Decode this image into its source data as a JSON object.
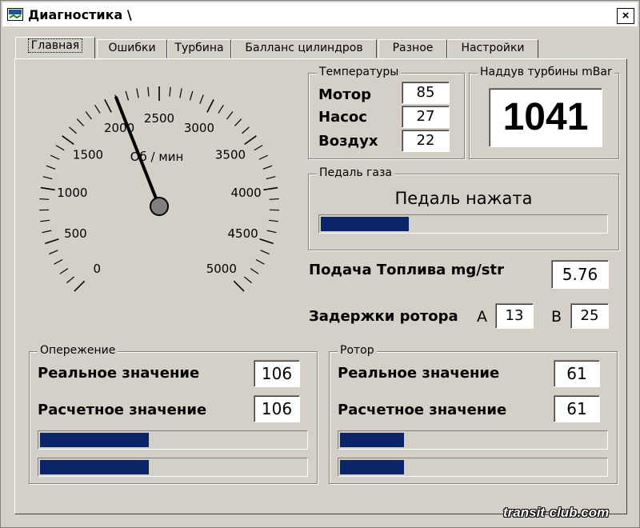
{
  "window": {
    "title": "Диагностика \\",
    "close": "×"
  },
  "tabs": [
    {
      "label": "Главная",
      "active": true
    },
    {
      "label": "Ошибки",
      "active": false
    },
    {
      "label": "Турбина",
      "active": false
    },
    {
      "label": "Балланс цилиндров",
      "active": false
    },
    {
      "label": "Разное",
      "active": false
    },
    {
      "label": "Настройки",
      "active": false
    }
  ],
  "gauge": {
    "unit_label": "Об / мин",
    "ticks": [
      "0",
      "500",
      "1000",
      "1500",
      "2000",
      "2500",
      "3000",
      "3500",
      "4000",
      "4500",
      "5000"
    ],
    "min": 0,
    "max": 5000,
    "value": 2100
  },
  "temperatures": {
    "title": "Температуры",
    "items": [
      {
        "label": "Мотор",
        "value": "85"
      },
      {
        "label": "Насос",
        "value": "27"
      },
      {
        "label": "Воздух",
        "value": "22"
      }
    ]
  },
  "boost": {
    "title": "Наддув турбины mBar",
    "value": "1041"
  },
  "pedal": {
    "title": "Педаль газа",
    "status": "Педаль нажата",
    "fill": 0.31
  },
  "fuel": {
    "label": "Подача Топлива mg/str",
    "value": "5.76"
  },
  "rotor_delay": {
    "label": "Задержки ротора",
    "a_label": "A",
    "a_value": "13",
    "b_label": "B",
    "b_value": "25"
  },
  "advance": {
    "title": "Опережение",
    "real_label": "Реальное значение",
    "real_value": "106",
    "calc_label": "Расчетное значение",
    "calc_value": "106",
    "bar1_fill": 0.41,
    "bar2_fill": 0.41
  },
  "rotor": {
    "title": "Ротор",
    "real_label": "Реальное значение",
    "real_value": "61",
    "calc_label": "Расчетное значение",
    "calc_value": "61",
    "bar1_fill": 0.24,
    "bar2_fill": 0.24
  },
  "watermark": "transit-club.com",
  "colors": {
    "bar": "#0a246a",
    "face": "#d4d0c8",
    "needle": "#000000"
  }
}
